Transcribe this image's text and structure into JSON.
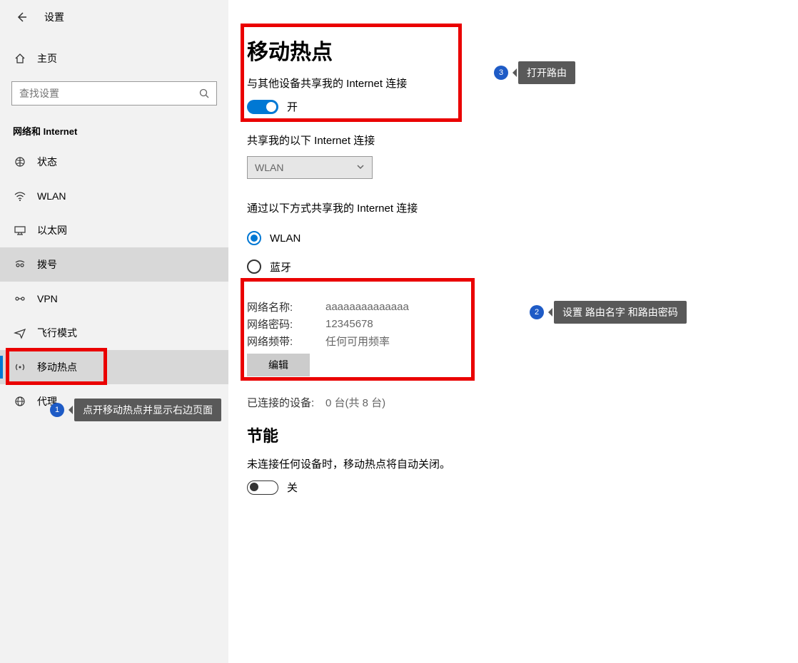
{
  "header": {
    "settings": "设置"
  },
  "sidebar": {
    "home": "主页",
    "search_placeholder": "查找设置",
    "group": "网络和 Internet",
    "items": [
      {
        "label": "状态"
      },
      {
        "label": "WLAN"
      },
      {
        "label": "以太网"
      },
      {
        "label": "拨号"
      },
      {
        "label": "VPN"
      },
      {
        "label": "飞行模式"
      },
      {
        "label": "移动热点"
      },
      {
        "label": "代理"
      }
    ]
  },
  "main": {
    "title": "移动热点",
    "share_label": "与其他设备共享我的 Internet 连接",
    "share_toggle_text": "开",
    "share_from_label": "共享我的以下 Internet 连接",
    "share_from_value": "WLAN",
    "share_via_label": "通过以下方式共享我的 Internet 连接",
    "radio_wlan": "WLAN",
    "radio_bt": "蓝牙",
    "net_name_k": "网络名称:",
    "net_name_v": "aaaaaaaaaaaaaa",
    "net_pwd_k": "网络密码:",
    "net_pwd_v": "12345678",
    "net_band_k": "网络频带:",
    "net_band_v": "任何可用频率",
    "edit": "编辑",
    "connected_k": "已连接的设备:",
    "connected_v": "0 台(共 8 台)",
    "power_title": "节能",
    "power_desc": "未连接任何设备时，移动热点将自动关闭。",
    "power_toggle_text": "关"
  },
  "callouts": {
    "c1": {
      "num": "1",
      "text": "点开移动热点并显示右边页面"
    },
    "c2": {
      "num": "2",
      "text": "设置 路由名字  和路由密码"
    },
    "c3": {
      "num": "3",
      "text": "打开路由"
    }
  }
}
